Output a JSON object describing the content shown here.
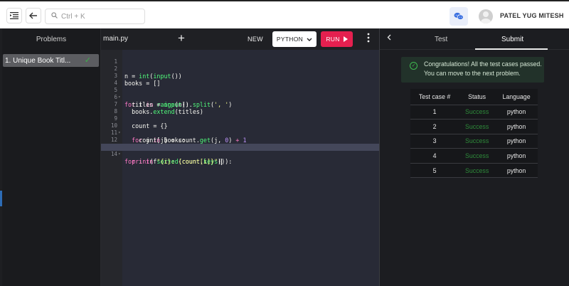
{
  "topbar": {
    "search_placeholder": "Ctrl + K",
    "username": "PATEL YUG MITESH"
  },
  "problems": {
    "header": "Problems",
    "items": [
      {
        "label": "1. Unique Book Titl...",
        "solved": true
      }
    ]
  },
  "editor": {
    "tab": "main.py",
    "add_tab": "+",
    "new_label": "NEW",
    "language": "PYTHON",
    "run_label": "RUN",
    "lines": [
      {
        "n": "1",
        "code": ""
      },
      {
        "n": "2",
        "code": "n = int(input())"
      },
      {
        "n": "3",
        "code": "books = []"
      },
      {
        "n": "4",
        "code": ""
      },
      {
        "n": "5",
        "code": "for i in range(n):"
      },
      {
        "n": "6",
        "code": "  titles = input().split(', ')"
      },
      {
        "n": "7",
        "code": "  books.extend(titles)"
      },
      {
        "n": "8",
        "code": ""
      },
      {
        "n": "9",
        "code": "  count = {}"
      },
      {
        "n": "10",
        "code": "  for j in books:"
      },
      {
        "n": "11",
        "code": "    count[j] = count.get(j, 0) + 1"
      },
      {
        "n": "12",
        "code": ""
      },
      {
        "n": "13",
        "code": "for i in sorted(count.keys()):"
      },
      {
        "n": "14",
        "code": "  print(f\"{i}: {count[i]}\")"
      }
    ],
    "active_line": "14"
  },
  "results": {
    "tabs": [
      "Test",
      "Submit"
    ],
    "active_tab": "Submit",
    "message_line1": "Congratulations! All the test cases passed.",
    "message_line2": "You can move to the next problem.",
    "columns": [
      "Test case #",
      "Status",
      "Language"
    ],
    "rows": [
      {
        "case": "1",
        "status": "Success",
        "language": "python"
      },
      {
        "case": "2",
        "status": "Success",
        "language": "python"
      },
      {
        "case": "3",
        "status": "Success",
        "language": "python"
      },
      {
        "case": "4",
        "status": "Success",
        "language": "python"
      },
      {
        "case": "5",
        "status": "Success",
        "language": "python"
      }
    ],
    "colors": {
      "success": "#2e8b3a",
      "run_button": "#e5204f"
    }
  }
}
